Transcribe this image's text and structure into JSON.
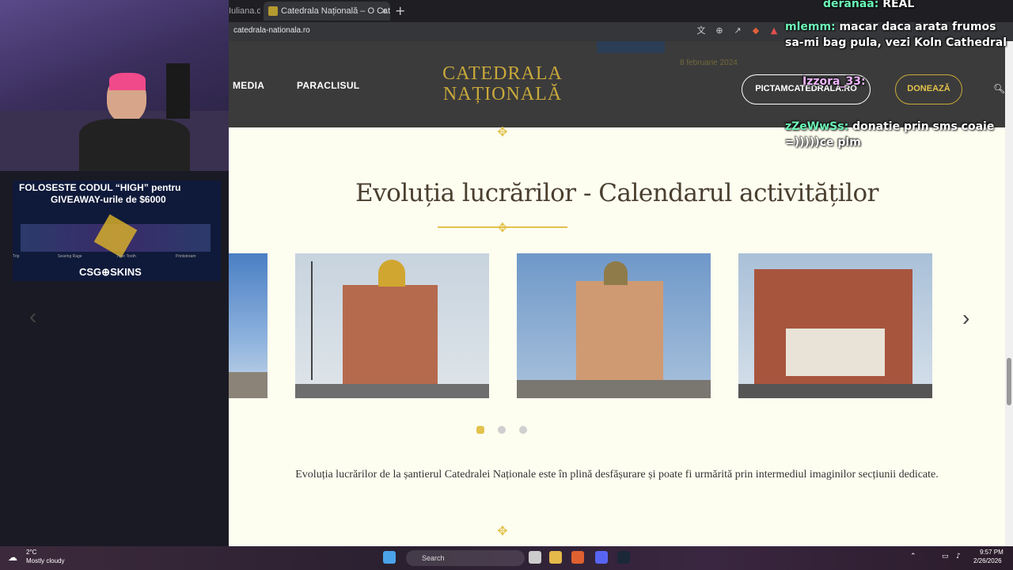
{
  "browser": {
    "prev_tab_label": "Iuliana.d",
    "active_tab_label": "Catedrala Națională – O Catedra",
    "url": "catedrala-nationala.ro"
  },
  "site": {
    "nav": [
      "MEDIA",
      "PARACLISUL"
    ],
    "logo_line1": "CATEDRALA",
    "logo_line2": "NAȚIONALĂ",
    "btn_pictam": "PICTAMCATEDRALA.RO",
    "btn_doneaza": "DONEAZĂ",
    "header_post_date": "8 februarie 2024"
  },
  "section": {
    "title": "Evoluția lucrărilor - Calendarul activităților",
    "description": "Evoluția lucrărilor de la șantierul Catedralei Naționale este în plină desfășurare și poate fi urmărită prin intermediul imaginilor secțiunii dedicate.",
    "slide_count_pages": 3,
    "active_dot_index": 0
  },
  "ad": {
    "line1": "FOLOSESTE CODUL “HIGH” pentru",
    "line2": "GIVEAWAY-urile de $6000",
    "brand": "CSG⊕SKINS",
    "skins": [
      "Trip",
      "Searing Rage",
      "Tiger Tooth",
      "Printstream"
    ]
  },
  "chat": [
    {
      "user": "deranaa:",
      "text": "REAL"
    },
    {
      "user": "mlemm:",
      "text": "macar daca arata frumos sa-mi bag pula, vezi Koln Cathedral"
    },
    {
      "user": "Izzora_33:",
      "text": ""
    },
    {
      "user": "zZeWwSs:",
      "text": "donatie prin sms coaie =)))))ce plm"
    }
  ],
  "taskbar": {
    "weather_temp": "2°C",
    "weather_desc": "Mostly cloudy",
    "search": "Search",
    "time": "9:57 PM",
    "date": "2/26/2026"
  },
  "colors": {
    "header_bg": "#3b3b3b",
    "gold": "#c9a93b",
    "page_bg": "#fdfdf0",
    "title_color": "#4a3f2f"
  }
}
